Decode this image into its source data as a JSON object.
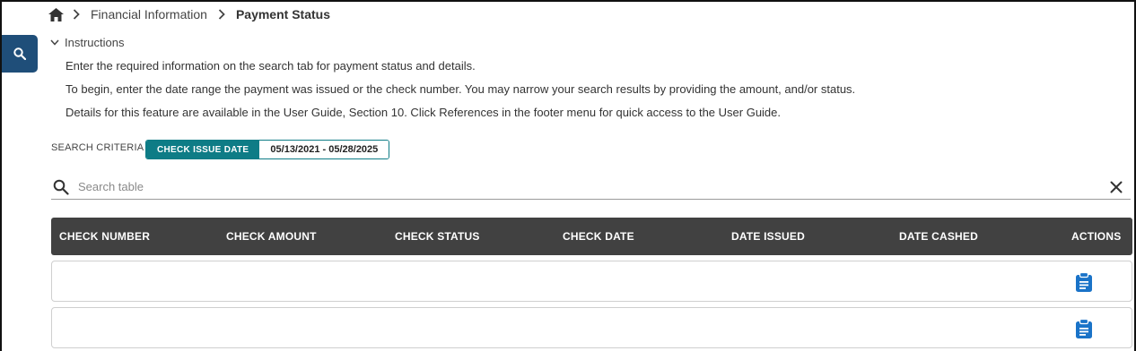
{
  "breadcrumb": {
    "home_icon": "home-icon",
    "items": [
      "Financial Information",
      "Payment Status"
    ]
  },
  "search_tab": {
    "icon": "search-icon",
    "color": "#1f4e79"
  },
  "instructions": {
    "toggle_label": "Instructions",
    "lines": [
      "Enter the required information on the search tab for payment status and details.",
      "To begin, enter the date range the payment was issued or the check number. You may narrow your search results by providing the amount, and/or status.",
      "Details for this feature are available in the User Guide, Section 10. Click References in the footer menu for quick access to the User Guide."
    ]
  },
  "search_criteria": {
    "label": "SEARCH CRITERIA",
    "chip_key": "CHECK ISSUE DATE",
    "chip_value": "05/13/2021 - 05/28/2025",
    "accent": "#0e7c86"
  },
  "table_search": {
    "placeholder": "Search table"
  },
  "table": {
    "header_bg": "#414141",
    "columns": [
      "CHECK NUMBER",
      "CHECK AMOUNT",
      "CHECK STATUS",
      "CHECK DATE",
      "DATE ISSUED",
      "DATE CASHED",
      "ACTIONS"
    ],
    "rows": [
      {
        "check_number": "",
        "check_amount": "",
        "check_status": "",
        "check_date": "",
        "date_issued": "",
        "date_cashed": "",
        "action_icon": "clipboard-icon"
      },
      {
        "check_number": "",
        "check_amount": "",
        "check_status": "",
        "check_date": "",
        "date_issued": "",
        "date_cashed": "",
        "action_icon": "clipboard-icon"
      }
    ],
    "action_color": "#1a73c8"
  }
}
